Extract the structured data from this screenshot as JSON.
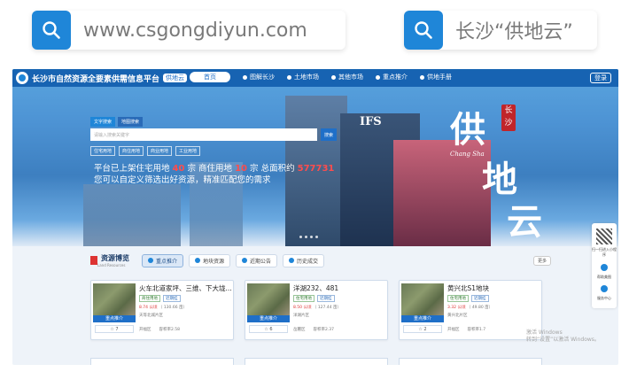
{
  "search_pills": [
    {
      "text": "www.csgongdiyun.com"
    },
    {
      "text": "长沙“供地云”"
    }
  ],
  "site": {
    "brand": "长沙市自然资源全要素供需信息平台",
    "badge": "供地云",
    "menu": [
      {
        "label": "首页",
        "active": true
      },
      {
        "label": "图解长沙"
      },
      {
        "label": "土地市场"
      },
      {
        "label": "其他市场"
      },
      {
        "label": "重点推介"
      },
      {
        "label": "供地手册"
      }
    ],
    "login": "登录"
  },
  "hero": {
    "search_tabs": [
      "文字搜索",
      "地图搜索"
    ],
    "search_placeholder": "请输入搜索关键字",
    "search_button": "搜索",
    "quick_tags": [
      "住宅用地",
      "商住用地",
      "商业用地",
      "工业用地"
    ],
    "stats_prefix": "平台已上架住宅用地",
    "residential_count": "40",
    "unit_ge": "宗",
    "stats_mid": "商住用地",
    "commercial_count": "10",
    "stats_total_label": "总面积约",
    "total_area": "577731",
    "stats_line2": "您可以自定义筛选出好资源，精准匹配您的需求",
    "calli_1": "供",
    "calli_2": "地",
    "calli_3": "云",
    "seal": "长沙",
    "en_text": "Chang Sha"
  },
  "resources": {
    "title": "资源博览",
    "subtitle": "Land Resources",
    "tabs": [
      {
        "label": "重点推介",
        "active": true
      },
      {
        "label": "地块资源"
      },
      {
        "label": "近期公告"
      },
      {
        "label": "历史成交"
      }
    ],
    "more": "更多"
  },
  "cards": [
    {
      "name": "火车北道家坪、三维、下大垅...",
      "chips": [
        "商住用地",
        "近期挂"
      ],
      "area": "8.74 公顷",
      "area_mu": "（ 130.66 亩）",
      "district": "天等北城片区",
      "zone": "开福区",
      "ratio": "容积率2.58",
      "tag": "重点推介",
      "fav": "☆ 7"
    },
    {
      "name": "洋湖232、481",
      "chips": [
        "住宅用地",
        "近期挂"
      ],
      "area": "8.50 公顷",
      "area_mu": "（ 127.44 亩）",
      "district": "洋湖片区",
      "zone": "岳麓区",
      "ratio": "容积率2.37",
      "tag": "重点推介",
      "fav": "☆ 6"
    },
    {
      "name": "黄兴北S1地块",
      "chips": [
        "住宅用地",
        "近期挂"
      ],
      "area": "3.32 公顷",
      "area_mu": "（ 49.80 亩）",
      "district": "黄兴北片区",
      "zone": "开福区",
      "ratio": "容积率1.7",
      "tag": "重点推介",
      "fav": "☆ 2"
    }
  ],
  "side_bar": {
    "qr_caption": "扫一扫进入小程序",
    "help": "帮助美图",
    "service": "服务中心"
  },
  "watermark": {
    "line1": "激活 Windows",
    "line2": "转到“设置”以激活 Windows。"
  },
  "colors": {
    "accent": "#1f86d8",
    "nav": "#0c58aa",
    "highlight_red": "#ff4d4d"
  }
}
